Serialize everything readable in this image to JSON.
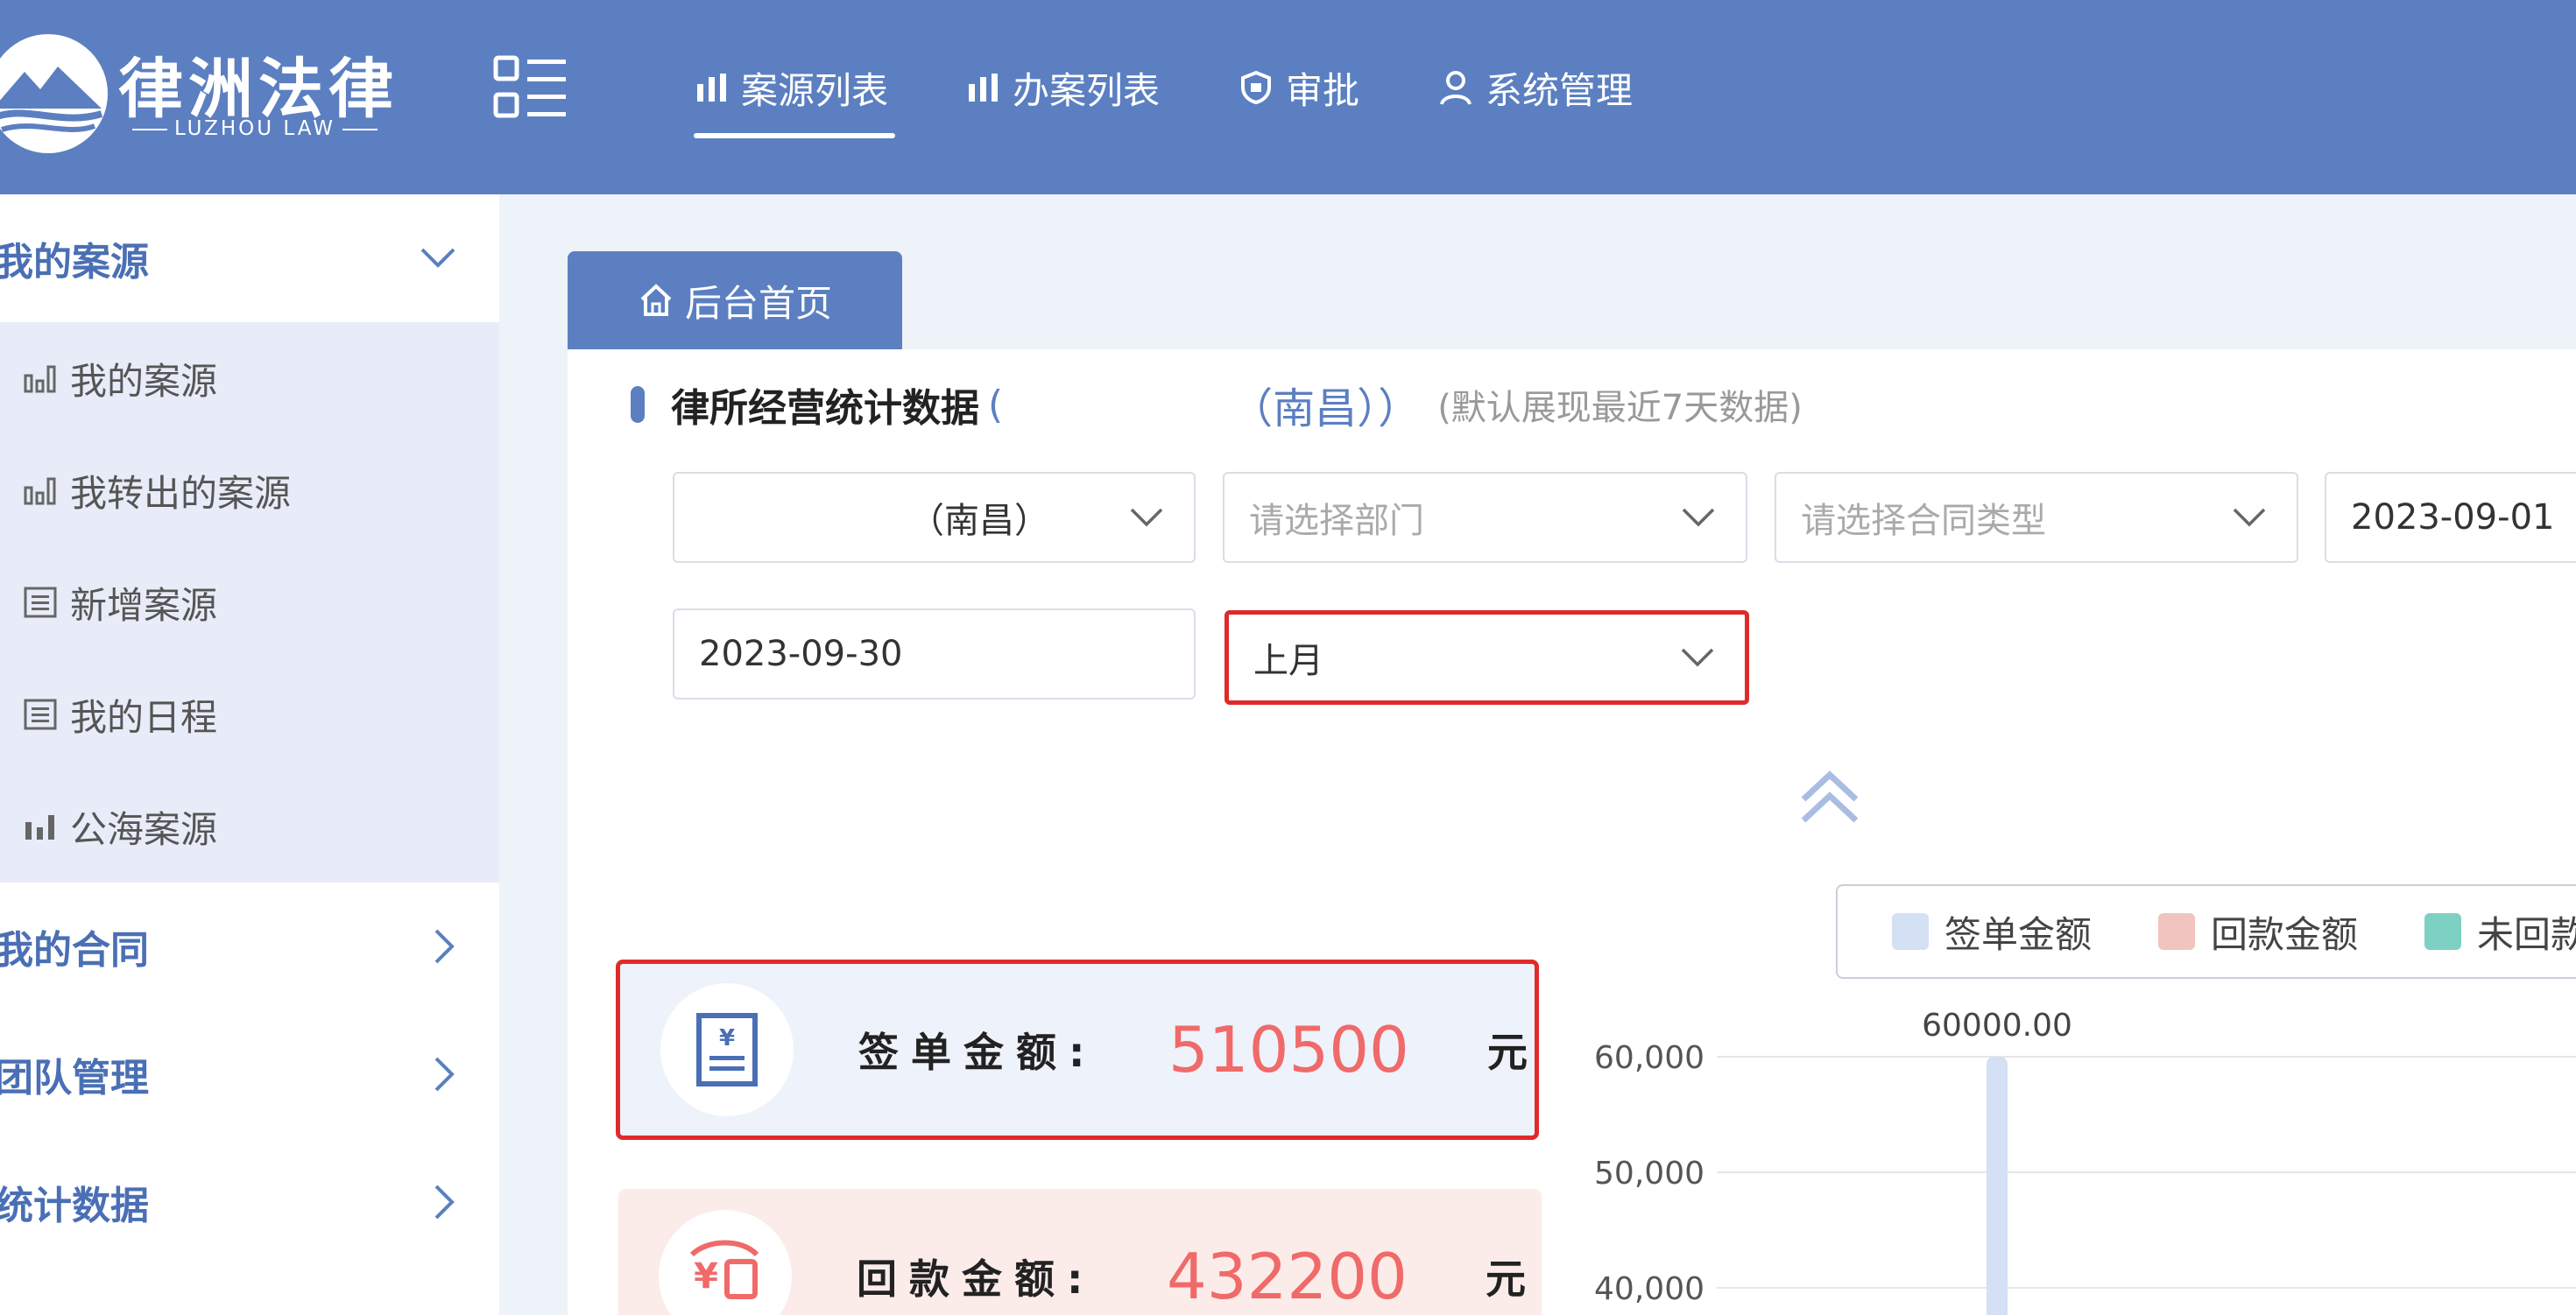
{
  "app": {
    "logo_cn": "律洲法律",
    "logo_en": "LUZHOU LAW"
  },
  "topnav": [
    {
      "label": "案源列表",
      "icon": "bar-chart-icon",
      "active": true
    },
    {
      "label": "办案列表",
      "icon": "bar-chart-icon",
      "active": false
    },
    {
      "label": "审批",
      "icon": "shield-icon",
      "active": false
    },
    {
      "label": "系统管理",
      "icon": "user-icon",
      "active": false
    }
  ],
  "sidebar": {
    "groups": [
      {
        "label": "我的案源",
        "expanded": true,
        "items": [
          {
            "label": "我的案源",
            "icon": "bar-chart-icon"
          },
          {
            "label": "我转出的案源",
            "icon": "bar-chart-icon"
          },
          {
            "label": "新增案源",
            "icon": "list-icon"
          },
          {
            "label": "我的日程",
            "icon": "list-icon"
          },
          {
            "label": "公海案源",
            "icon": "bar-chart-icon"
          }
        ]
      },
      {
        "label": "我的合同",
        "expanded": false
      },
      {
        "label": "团队管理",
        "expanded": false
      },
      {
        "label": "统计数据",
        "expanded": false
      }
    ]
  },
  "tabs": {
    "home": "后台首页"
  },
  "stats_section": {
    "title": "律所经营统计数据",
    "title_paren_open": "(",
    "title_org": "（南昌））",
    "note": "(默认展现最近7天数据)"
  },
  "filters": {
    "org_value": "（南昌）",
    "dept_placeholder": "请选择部门",
    "contract_type_placeholder": "请选择合同类型",
    "start_date": "2023-09-01",
    "end_date": "2023-09-30",
    "period_value": "上月"
  },
  "cards": {
    "sign": {
      "label": "签单金额:",
      "value": "510500",
      "unit": "元"
    },
    "back": {
      "label": "回款金额:",
      "value": "432200",
      "unit": "元"
    }
  },
  "legend": [
    "签单金额",
    "回款金额",
    "未回款"
  ],
  "colors": {
    "header": "#5b7fc1",
    "sign": "#d4e0f4",
    "back": "#f2c4be",
    "unpaid": "#7dd1c2",
    "value_red": "#f06a6a"
  },
  "chart_data": {
    "type": "bar",
    "series": [
      {
        "name": "签单金额",
        "values": [
          60000
        ]
      }
    ],
    "data_labels": [
      "60000.00"
    ],
    "y_ticks": [
      "60,000",
      "50,000",
      "40,000"
    ],
    "ylim": [
      40000,
      60000
    ],
    "grid": true
  }
}
